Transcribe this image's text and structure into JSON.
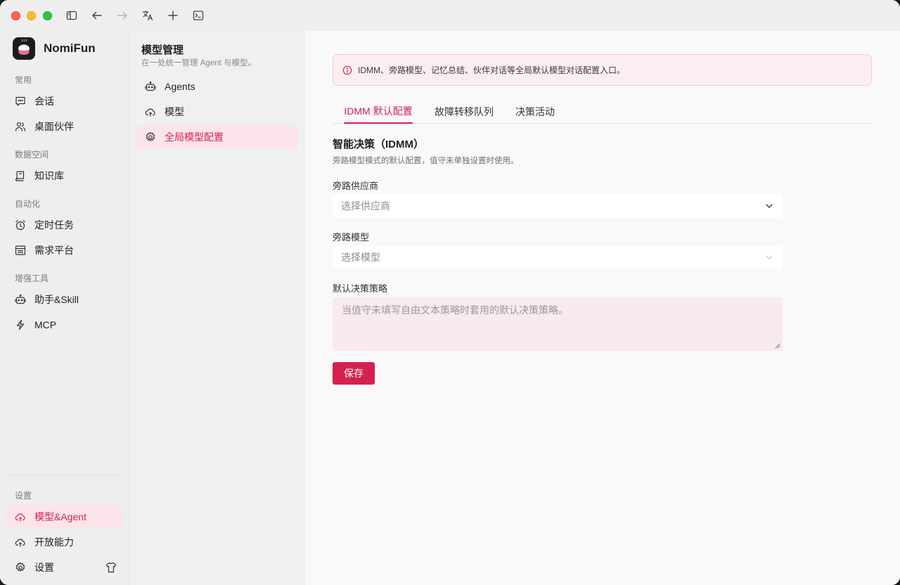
{
  "app": {
    "name": "NomiFun"
  },
  "sidebar": {
    "sections": {
      "common": "常用",
      "data_space": "数据空间",
      "automation": "自动化",
      "tools": "增强工具",
      "settings": "设置"
    },
    "items": {
      "chat": {
        "label": "会话",
        "icon": "chat-icon"
      },
      "partner": {
        "label": "桌面伙伴",
        "icon": "users-icon"
      },
      "knowledge": {
        "label": "知识库",
        "icon": "book-icon"
      },
      "schedule": {
        "label": "定时任务",
        "icon": "alarm-icon"
      },
      "demand": {
        "label": "需求平台",
        "icon": "list-icon"
      },
      "assistant": {
        "label": "助手&Skill",
        "icon": "robot-icon"
      },
      "mcp": {
        "label": "MCP",
        "icon": "bolt-icon"
      },
      "model_agent": {
        "label": "模型&Agent",
        "icon": "cloud-icon",
        "active": true
      },
      "open_ability": {
        "label": "开放能力",
        "icon": "cloud-icon"
      },
      "settings": {
        "label": "设置",
        "icon": "gear-icon"
      }
    }
  },
  "panel": {
    "title": "模型管理",
    "subtitle": "在一处统一管理 Agent 与模型。",
    "items": [
      {
        "label": "Agents",
        "icon": "robot-icon"
      },
      {
        "label": "模型",
        "icon": "cloud-icon"
      },
      {
        "label": "全局模型配置",
        "icon": "gear-icon",
        "active": true
      }
    ]
  },
  "main": {
    "alert": "IDMM、旁路模型、记忆总结、伙伴对话等全局默认模型对话配置入口。",
    "tabs": [
      {
        "label": "IDMM 默认配置",
        "active": true
      },
      {
        "label": "故障转移队列"
      },
      {
        "label": "决策活动"
      }
    ],
    "section_title": "智能决策（IDMM）",
    "section_desc": "旁路模型模式的默认配置，值守未单独设置时使用。",
    "fields": {
      "provider": {
        "label": "旁路供应商",
        "placeholder": "选择供应商"
      },
      "model": {
        "label": "旁路模型",
        "placeholder": "选择模型"
      },
      "strategy": {
        "label": "默认决策策略",
        "placeholder": "当值守未填写自由文本策略时套用的默认决策策略。"
      }
    },
    "save_label": "保存"
  },
  "colors": {
    "accent": "#d6204f",
    "accent_bg": "#fbe4ea",
    "alert_bg": "#fbeef1",
    "alert_border": "#f4c7d3"
  }
}
